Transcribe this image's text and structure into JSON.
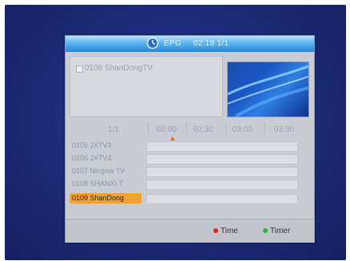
{
  "header": {
    "title": "EPG",
    "time": "02:19 1/1"
  },
  "channel_info": {
    "name": "0109 ShanDongTV"
  },
  "timeline": {
    "page": "1/1",
    "slots": [
      "02:00",
      "02:30",
      "03:00",
      "03:30"
    ]
  },
  "channels": [
    {
      "label": "0105  JXTV3"
    },
    {
      "label": "0106  JXTV4"
    },
    {
      "label": "0107  Ningxia TV"
    },
    {
      "label": "0108  SHANXI T"
    },
    {
      "label": "0109  ShanDong"
    }
  ],
  "footer": {
    "time_label": "Time",
    "timer_label": "Timer"
  },
  "colors": {
    "selection": "#f3a233",
    "red_key": "#e02222",
    "green_key": "#2fae2f",
    "titlebar": "#5ab3ef"
  },
  "icons": {
    "title_icon": "clock-icon",
    "red_key_icon": "red-dot-icon",
    "green_key_icon": "green-dot-icon"
  }
}
